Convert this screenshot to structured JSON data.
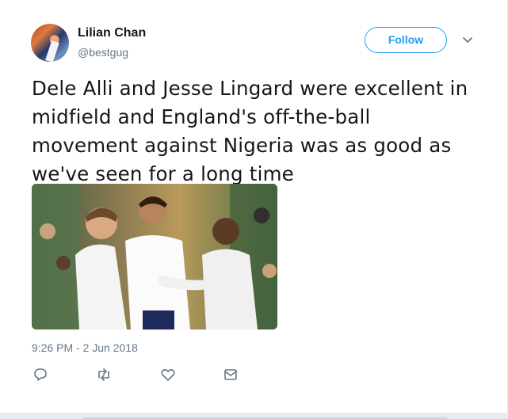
{
  "tweet": {
    "author": {
      "display_name": "Lilian Chan",
      "handle": "@bestgug",
      "avatar_icon": "profile-avatar"
    },
    "follow_label": "Follow",
    "menu_icon": "chevron-down-icon",
    "text": "Dele Alli and Jesse Lingard were excellent in midfield and England's off-the-ball movement against Nigeria was as good as we've seen for a long time",
    "media": {
      "type": "photo"
    },
    "timestamp": "9:26 PM - 2 Jun 2018",
    "actions": [
      {
        "name": "reply",
        "icon": "reply-icon"
      },
      {
        "name": "retweet",
        "icon": "retweet-icon"
      },
      {
        "name": "like",
        "icon": "heart-icon"
      },
      {
        "name": "direct-message",
        "icon": "envelope-icon"
      }
    ]
  },
  "colors": {
    "accent": "#1da1f2",
    "text": "#14171a",
    "secondary": "#657786"
  }
}
